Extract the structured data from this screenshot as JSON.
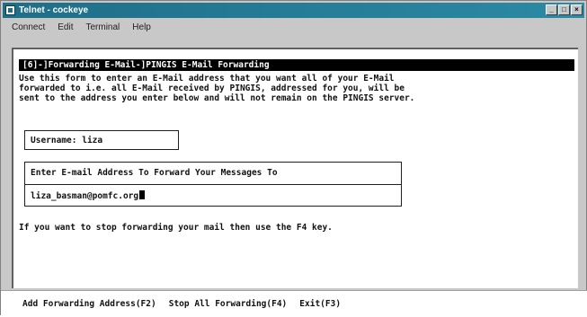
{
  "window": {
    "title": "Telnet - cockeye",
    "controls": {
      "minimize": "_",
      "maximize": "□",
      "close": "×"
    }
  },
  "menu": {
    "items": [
      {
        "label": "Connect"
      },
      {
        "label": "Edit"
      },
      {
        "label": "Terminal"
      },
      {
        "label": "Help"
      }
    ]
  },
  "terminal": {
    "header": "[6]-]Forwarding E-Mail-]PINGIS E-Mail Forwarding",
    "description": "Use this form to enter an E-Mail address that you want all of your E-Mail\nforwarded to i.e. all E-Mail received by PINGIS, addressed for you, will be\nsent to the address you enter below and will not remain on the PINGIS server.",
    "username_label": "Username:",
    "username_value": "liza",
    "forward_prompt": "Enter E-mail Address To Forward Your Messages To",
    "forward_value": "liza_basman@pomfc.org",
    "stop_hint": "If you want to stop forwarding your mail then use the F4 key."
  },
  "footer": {
    "keys": [
      {
        "label": "Add Forwarding Address(F2)"
      },
      {
        "label": "Stop All Forwarding(F4)"
      },
      {
        "label": "Exit(F3)"
      }
    ]
  },
  "colors": {
    "titlebar": "#1f6e87",
    "window_bg": "#c8c8c8",
    "terminal_bg": "#ffffff",
    "text": "#111111"
  }
}
